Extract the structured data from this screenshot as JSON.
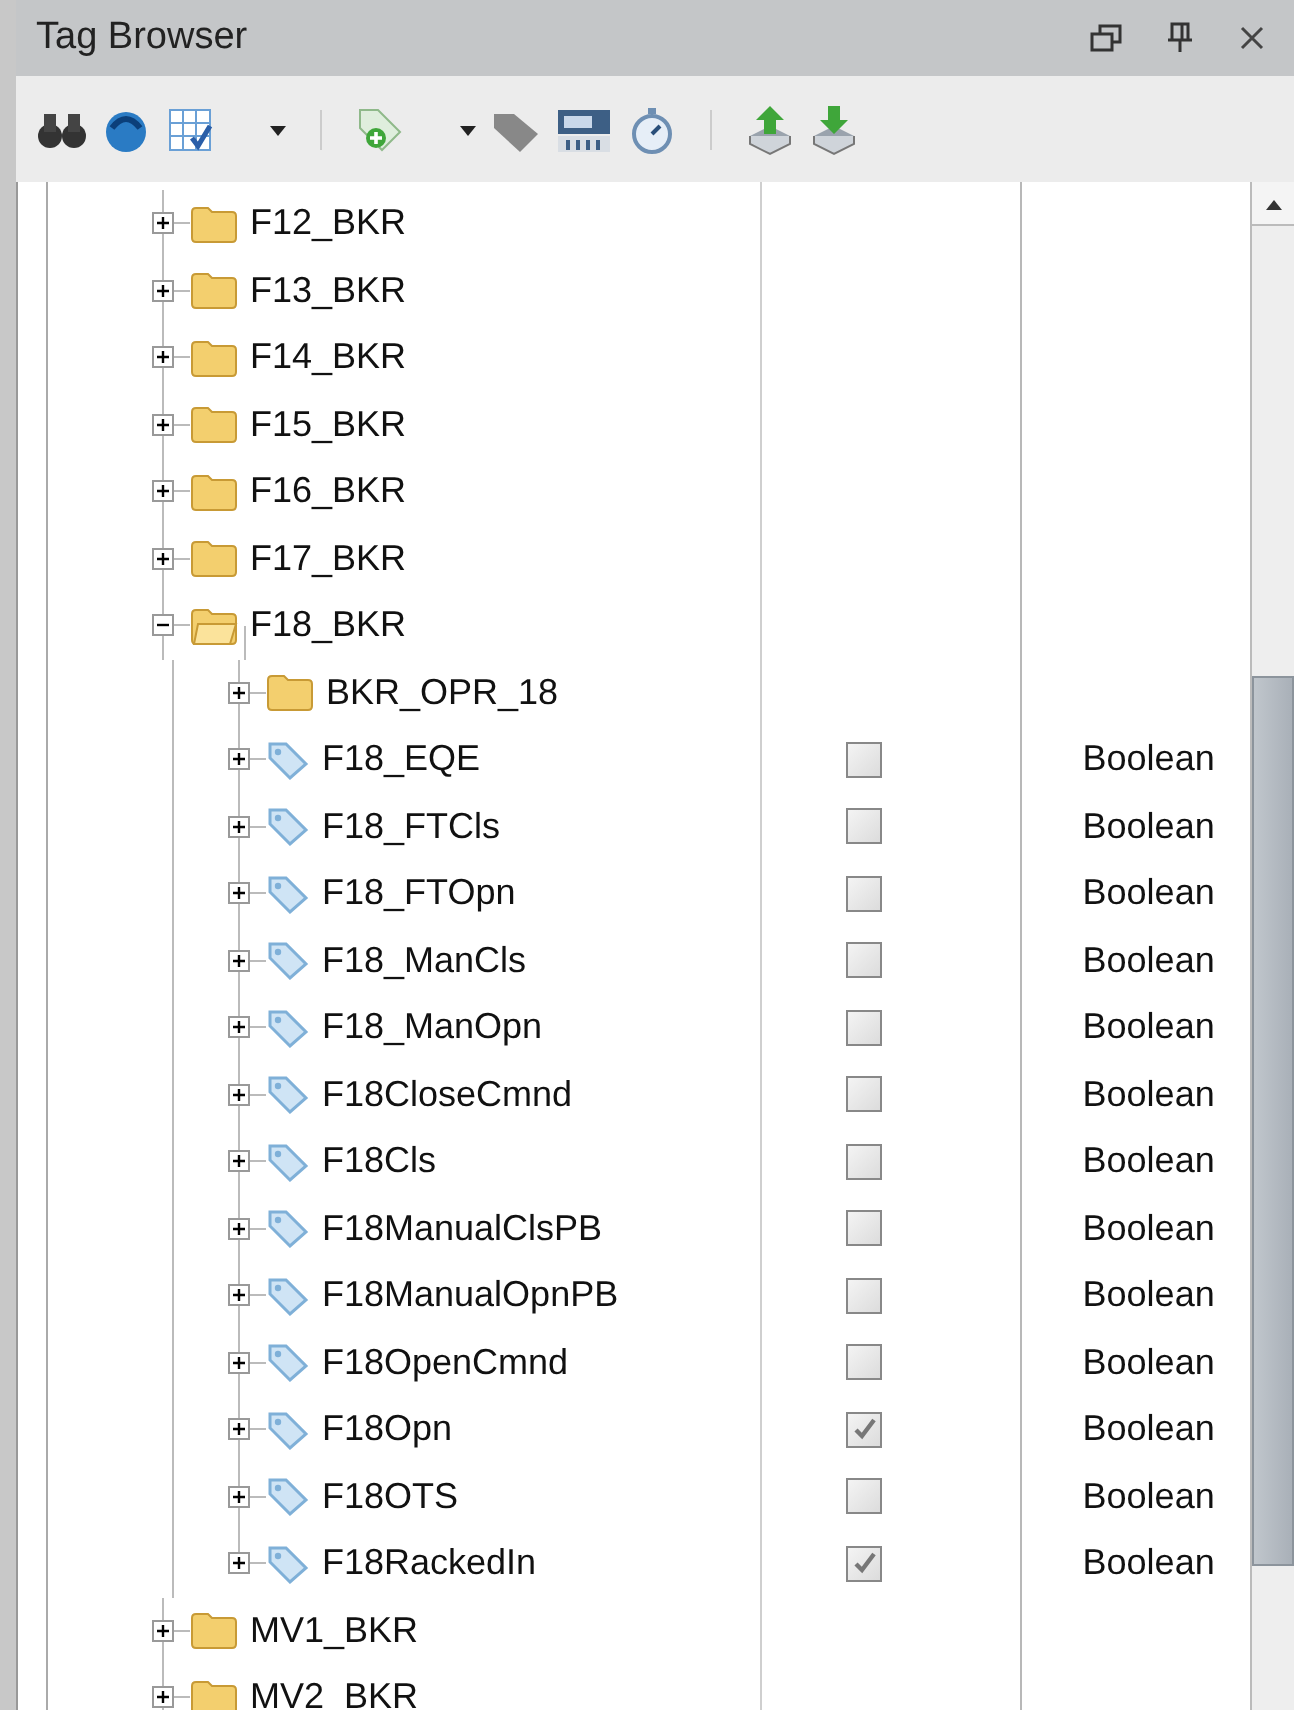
{
  "window": {
    "title": "Tag Browser"
  },
  "tree": [
    {
      "kind": "folder",
      "label": "F12_BKR",
      "expanded": false
    },
    {
      "kind": "folder",
      "label": "F13_BKR",
      "expanded": false
    },
    {
      "kind": "folder",
      "label": "F14_BKR",
      "expanded": false
    },
    {
      "kind": "folder",
      "label": "F15_BKR",
      "expanded": false
    },
    {
      "kind": "folder",
      "label": "F16_BKR",
      "expanded": false
    },
    {
      "kind": "folder",
      "label": "F17_BKR",
      "expanded": false
    },
    {
      "kind": "folder",
      "label": "F18_BKR",
      "expanded": true,
      "children": [
        {
          "kind": "folder",
          "label": "BKR_OPR_18",
          "expanded": false
        },
        {
          "kind": "tag",
          "label": "F18_EQE",
          "expanded": false,
          "checked": false,
          "type": "Boolean"
        },
        {
          "kind": "tag",
          "label": "F18_FTCls",
          "expanded": false,
          "checked": false,
          "type": "Boolean"
        },
        {
          "kind": "tag",
          "label": "F18_FTOpn",
          "expanded": false,
          "checked": false,
          "type": "Boolean"
        },
        {
          "kind": "tag",
          "label": "F18_ManCls",
          "expanded": false,
          "checked": false,
          "type": "Boolean"
        },
        {
          "kind": "tag",
          "label": "F18_ManOpn",
          "expanded": false,
          "checked": false,
          "type": "Boolean"
        },
        {
          "kind": "tag",
          "label": "F18CloseCmnd",
          "expanded": false,
          "checked": false,
          "type": "Boolean"
        },
        {
          "kind": "tag",
          "label": "F18Cls",
          "expanded": false,
          "checked": false,
          "type": "Boolean"
        },
        {
          "kind": "tag",
          "label": "F18ManualClsPB",
          "expanded": false,
          "checked": false,
          "type": "Boolean"
        },
        {
          "kind": "tag",
          "label": "F18ManualOpnPB",
          "expanded": false,
          "checked": false,
          "type": "Boolean"
        },
        {
          "kind": "tag",
          "label": "F18OpenCmnd",
          "expanded": false,
          "checked": false,
          "type": "Boolean"
        },
        {
          "kind": "tag",
          "label": "F18Opn",
          "expanded": false,
          "checked": true,
          "type": "Boolean"
        },
        {
          "kind": "tag",
          "label": "F18OTS",
          "expanded": false,
          "checked": false,
          "type": "Boolean"
        },
        {
          "kind": "tag",
          "label": "F18RackedIn",
          "expanded": false,
          "checked": true,
          "type": "Boolean"
        }
      ]
    },
    {
      "kind": "folder",
      "label": "MV1_BKR",
      "expanded": false
    },
    {
      "kind": "folder",
      "label": "MV2_BKR",
      "expanded": false
    }
  ]
}
